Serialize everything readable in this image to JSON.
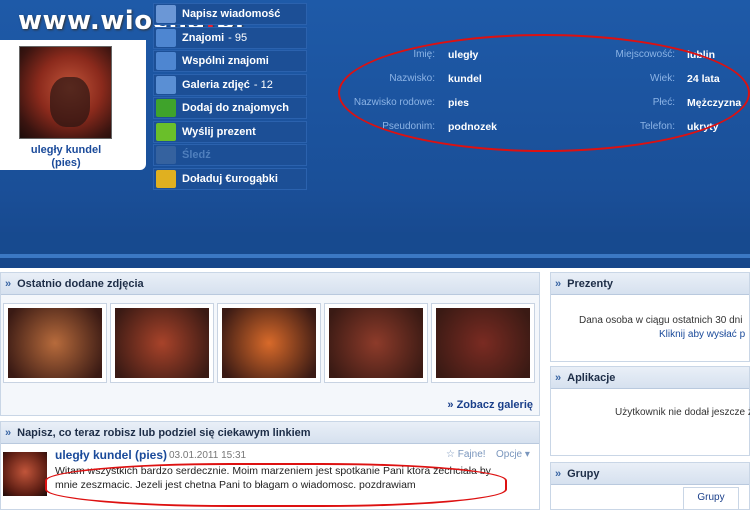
{
  "watermark": {
    "main": "www.wiocha",
    "dot": ".",
    "tld": "pl"
  },
  "profile": {
    "name": "uległy kundel",
    "nick": "(pies)"
  },
  "menu": [
    {
      "label": "Napisz wiadomość",
      "count": "",
      "icon": "envelope-icon",
      "icon_color": "#6b97d6",
      "disabled": false
    },
    {
      "label": "Znajomi",
      "count": "- 95",
      "icon": "people-icon",
      "icon_color": "#4e86d1",
      "disabled": false
    },
    {
      "label": "Wspólni znajomi",
      "count": "",
      "icon": "mutual-friends-icon",
      "icon_color": "#4e86d1",
      "disabled": false
    },
    {
      "label": "Galeria zdjęć",
      "count": "- 12",
      "icon": "gallery-icon",
      "icon_color": "#5a8fd4",
      "disabled": false
    },
    {
      "label": "Dodaj do znajomych",
      "count": "",
      "icon": "add-friend-icon",
      "icon_color": "#3fa32b",
      "disabled": false
    },
    {
      "label": "Wyślij prezent",
      "count": "",
      "icon": "gift-icon",
      "icon_color": "#6abf2a",
      "disabled": false
    },
    {
      "label": "Śledź",
      "count": "",
      "icon": "eye-icon",
      "icon_color": "#35629f",
      "disabled": true
    },
    {
      "label": "Doładuj €urogąbki",
      "count": "",
      "icon": "euro-icon",
      "icon_color": "#e0b020",
      "disabled": false
    }
  ],
  "info": [
    {
      "l1": "Imię:",
      "v1": "uległy",
      "l2": "Miejscowość:",
      "v2": "lublin"
    },
    {
      "l1": "Nazwisko:",
      "v1": "kundel",
      "l2": "Wiek:",
      "v2": "24 lata"
    },
    {
      "l1": "Nazwisko rodowe:",
      "v1": "pies",
      "l2": "Płeć:",
      "v2": "Mężczyzna"
    },
    {
      "l1": "Pseudonim:",
      "v1": "podnozek",
      "l2": "Telefon:",
      "v2": "ukryty"
    }
  ],
  "photos": {
    "title": "Ostatnio dodane zdjęcia",
    "more": "» Zobacz galerię",
    "thumbs": [
      "#b76b3c",
      "#a8432a",
      "#d86a2a",
      "#8d3b2a",
      "#7a2b22"
    ]
  },
  "status": {
    "title": "Napisz, co teraz robisz lub podziel się ciekawym linkiem",
    "author": "uległy kundel (pies)",
    "date": "03.01.2011 15:31",
    "fajne": "☆ Fajne!",
    "opcje": "Opcje ▾",
    "text": "Witam wszystkich bardzo serdecznie. Moim marzeniem jest spotkanie Pani ktora zechciala by mnie zeszmacic. Jezeli jest chetna Pani to błagam o wiadomosc. pozdrawiam"
  },
  "right": {
    "prezenty_title": "Prezenty",
    "prezenty_line1": "Dana osoba w ciągu ostatnich 30 dni",
    "prezenty_line2": "Kliknij aby wysłać p",
    "aplikacje_title": "Aplikacje",
    "aplikacje_line": "Użytkownik nie dodał jeszcze ż",
    "grupy_title": "Grupy",
    "grupy_tab": "Grupy"
  }
}
